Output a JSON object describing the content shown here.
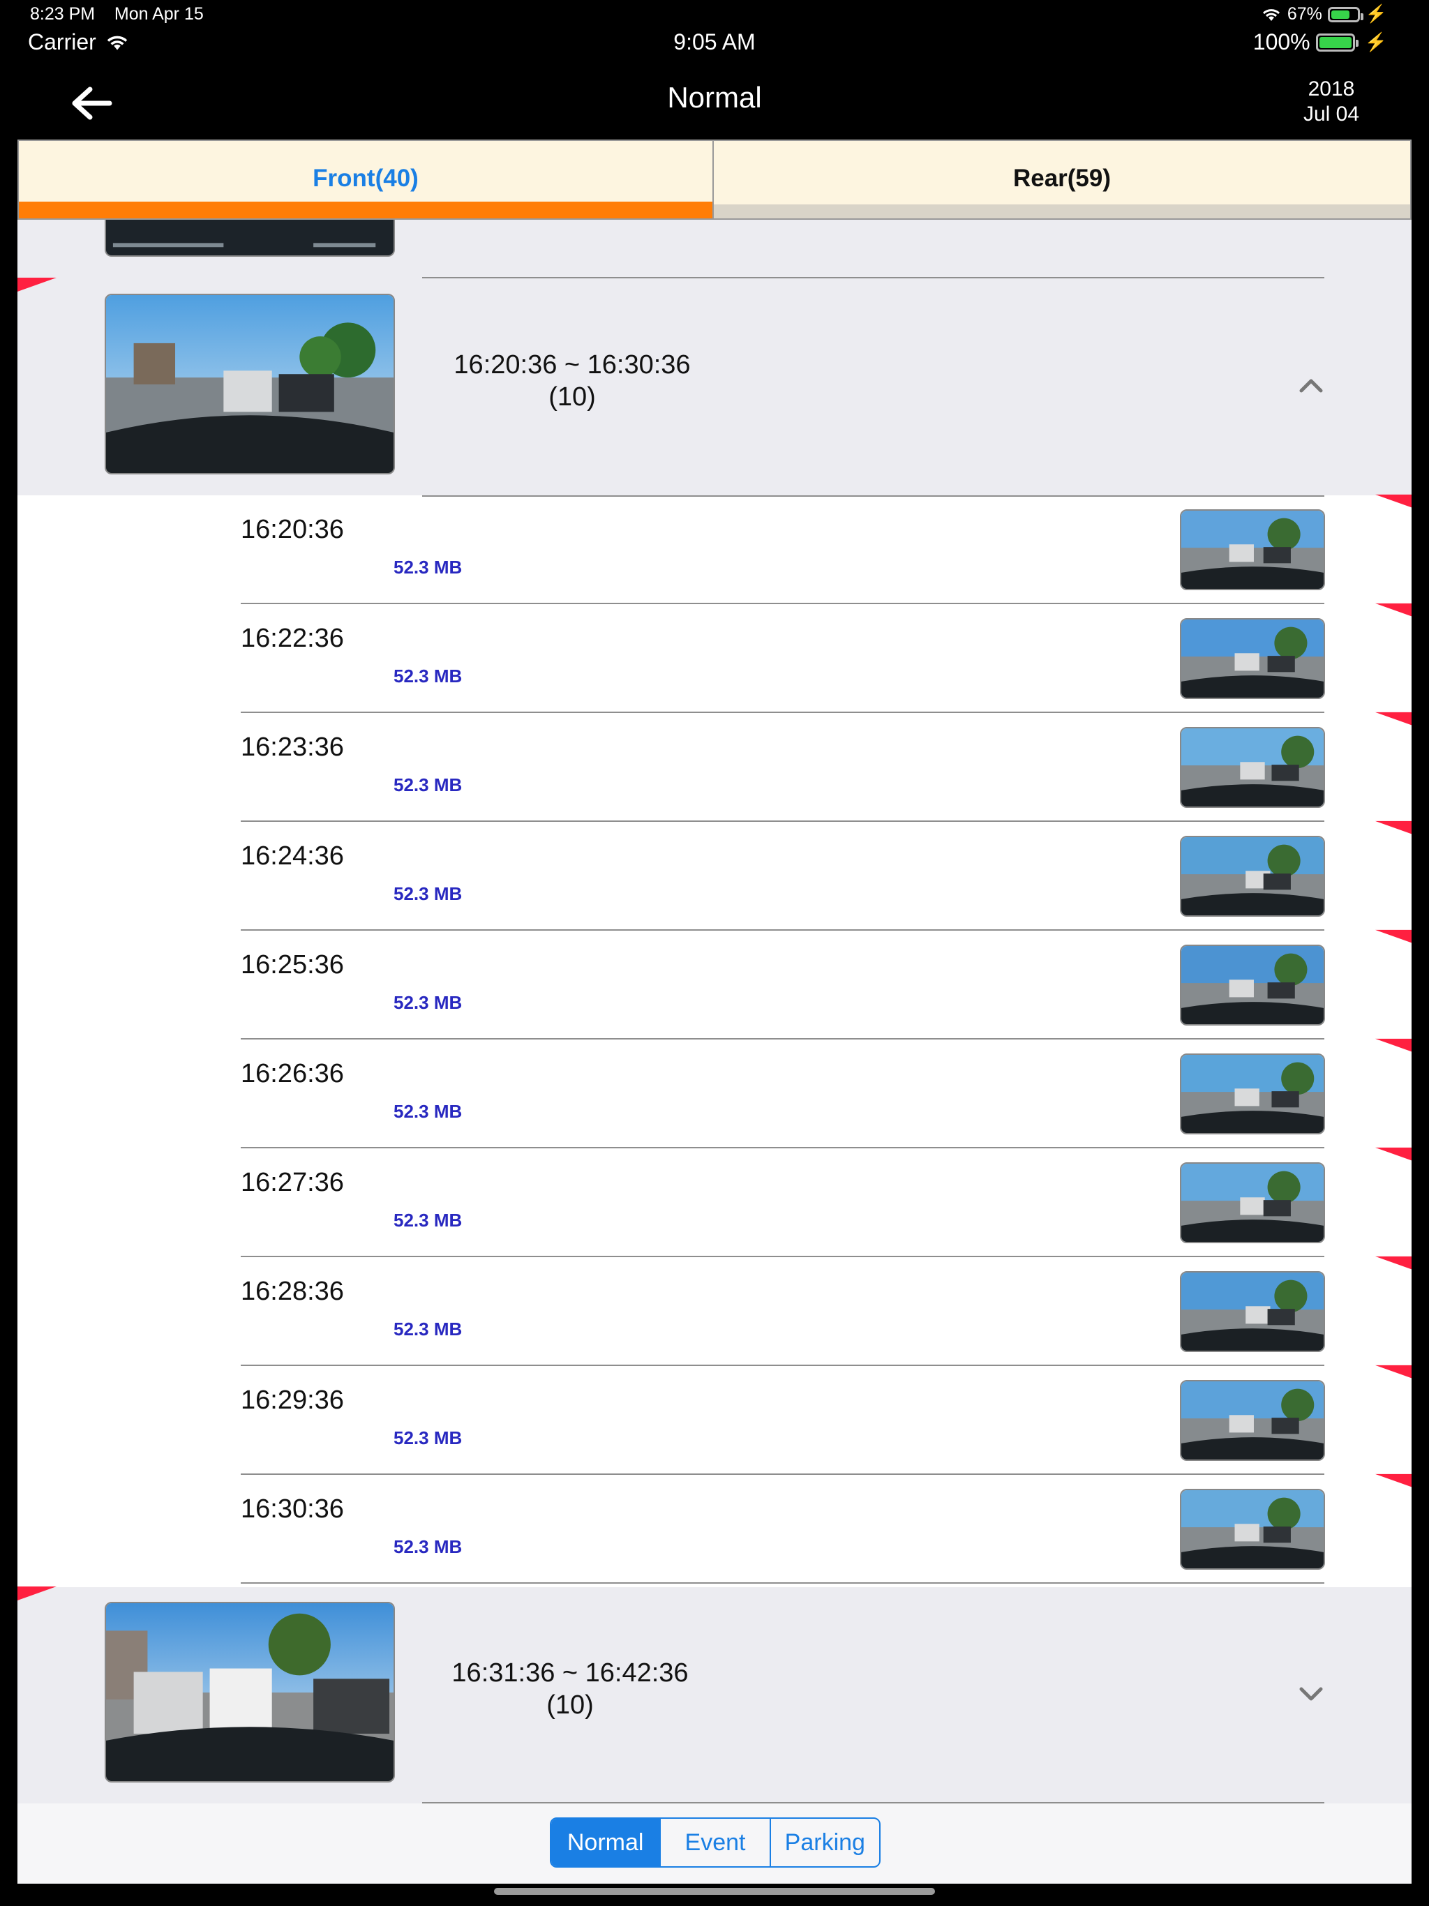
{
  "system_bar": {
    "time": "8:23 PM",
    "date": "Mon Apr 15",
    "battery": "67%"
  },
  "status_bar": {
    "carrier": "Carrier",
    "time": "9:05 AM",
    "battery": "100%"
  },
  "nav": {
    "title": "Normal",
    "year": "2018",
    "month_day": "Jul 04"
  },
  "tabs": [
    {
      "label": "Front(40)",
      "selected": true
    },
    {
      "label": "Rear(59)",
      "selected": false
    }
  ],
  "groups": [
    {
      "range": "16:20:36 ~ 16:30:36",
      "count": "(10)",
      "expanded": true
    },
    {
      "range": "16:31:36 ~ 16:42:36",
      "count": "(10)",
      "expanded": false
    }
  ],
  "items": [
    {
      "time": "16:20:36",
      "size": "52.3 MB"
    },
    {
      "time": "16:22:36",
      "size": "52.3 MB"
    },
    {
      "time": "16:23:36",
      "size": "52.3 MB"
    },
    {
      "time": "16:24:36",
      "size": "52.3 MB"
    },
    {
      "time": "16:25:36",
      "size": "52.3 MB"
    },
    {
      "time": "16:26:36",
      "size": "52.3 MB"
    },
    {
      "time": "16:27:36",
      "size": "52.3 MB"
    },
    {
      "time": "16:28:36",
      "size": "52.3 MB"
    },
    {
      "time": "16:29:36",
      "size": "52.3 MB"
    },
    {
      "time": "16:30:36",
      "size": "52.3 MB"
    }
  ],
  "segments": [
    "Normal",
    "Event",
    "Parking"
  ],
  "colors": {
    "accent": "#1a7fe4",
    "tab_underline": "#ff7d07",
    "size_text": "#2828c0",
    "flag": "#ff2040"
  }
}
